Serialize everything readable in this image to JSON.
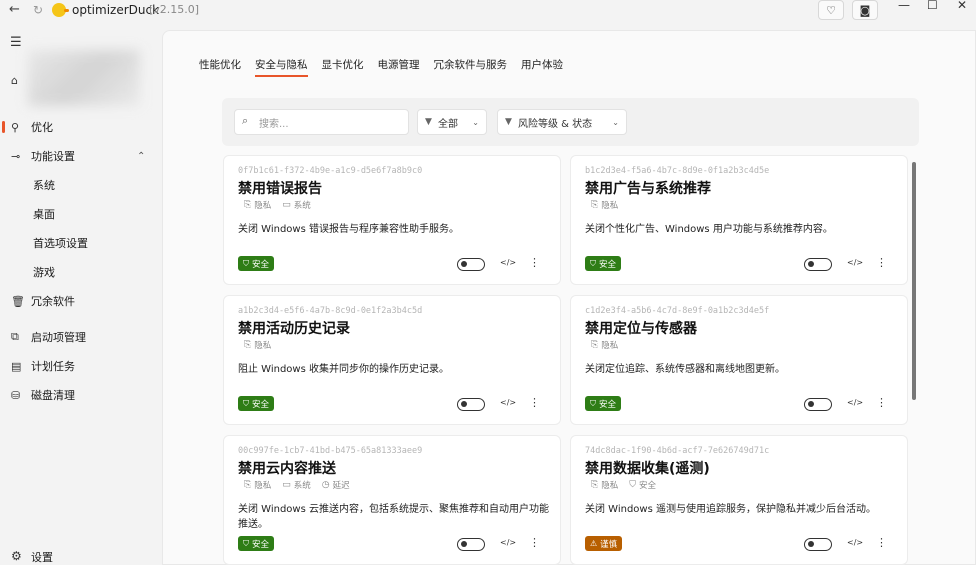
{
  "titlebar": {
    "app_name": "optimizerDuck",
    "version": "[v2.15.0]",
    "back_icon": "arrow-left-icon",
    "refresh_icon": "refresh-icon"
  },
  "sidebar": {
    "items": [
      {
        "id": "optimize",
        "label": "优化",
        "icon": "rocket-icon",
        "active": true
      },
      {
        "id": "feature-settings",
        "label": "功能设置",
        "icon": "toggle-icon",
        "expanded": true
      },
      {
        "id": "system",
        "label": "系统",
        "sub": true
      },
      {
        "id": "desktop",
        "label": "桌面",
        "sub": true
      },
      {
        "id": "preferences",
        "label": "首选项设置",
        "sub": true
      },
      {
        "id": "games",
        "label": "游戏",
        "sub": true
      },
      {
        "id": "bloatware",
        "label": "冗余软件",
        "icon": "trash-icon"
      },
      {
        "id": "startup",
        "label": "启动项管理",
        "icon": "startup-icon"
      },
      {
        "id": "tasks",
        "label": "计划任务",
        "icon": "calendar-icon"
      },
      {
        "id": "disk",
        "label": "磁盘清理",
        "icon": "disk-icon"
      }
    ],
    "settings_label": "设置"
  },
  "tabs": [
    "性能优化",
    "安全与隐私",
    "显卡优化",
    "电源管理",
    "冗余软件与服务",
    "用户体验"
  ],
  "active_tab": 1,
  "filter": {
    "search_placeholder": "搜索...",
    "category_label": "全部",
    "risk_label": "风险等级 & 状态"
  },
  "colors": {
    "accent": "#e8552a",
    "safe": "#2e7d16",
    "caution": "#b85f00"
  },
  "cards": [
    {
      "uuid": "0f7b1c61-f372-4b9e-a1c9-d5e6f7a8b9c0",
      "title": "禁用错误报告",
      "tags": [
        {
          "icon": "privacy-icon",
          "label": "隐私"
        },
        {
          "icon": "monitor-icon",
          "label": "系统"
        }
      ],
      "description": "关闭 Windows 错误报告与程序兼容性助手服务。",
      "badge": "安全",
      "badge_type": "safe"
    },
    {
      "uuid": "b1c2d3e4-f5a6-4b7c-8d9e-0f1a2b3c4d5e",
      "title": "禁用广告与系统推荐",
      "tags": [
        {
          "icon": "privacy-icon",
          "label": "隐私"
        }
      ],
      "description": "关闭个性化广告、Windows 用户功能与系统推荐内容。",
      "badge": "安全",
      "badge_type": "safe"
    },
    {
      "uuid": "a1b2c3d4-e5f6-4a7b-8c9d-0e1f2a3b4c5d",
      "title": "禁用活动历史记录",
      "tags": [
        {
          "icon": "privacy-icon",
          "label": "隐私"
        }
      ],
      "description": "阻止 Windows 收集并同步你的操作历史记录。",
      "badge": "安全",
      "badge_type": "safe"
    },
    {
      "uuid": "c1d2e3f4-a5b6-4c7d-8e9f-0a1b2c3d4e5f",
      "title": "禁用定位与传感器",
      "tags": [
        {
          "icon": "privacy-icon",
          "label": "隐私"
        }
      ],
      "description": "关闭定位追踪、系统传感器和离线地图更新。",
      "badge": "安全",
      "badge_type": "safe"
    },
    {
      "uuid": "00c997fe-1cb7-41bd-b475-65a81333aee9",
      "title": "禁用云内容推送",
      "tags": [
        {
          "icon": "privacy-icon",
          "label": "隐私"
        },
        {
          "icon": "monitor-icon",
          "label": "系统"
        },
        {
          "icon": "clock-icon",
          "label": "延迟"
        }
      ],
      "description": "关闭 Windows 云推送内容，包括系统提示、聚焦推荐和自动用户功能推送。",
      "badge": "安全",
      "badge_type": "safe"
    },
    {
      "uuid": "74dc8dac-1f90-4b6d-acf7-7e626749d71c",
      "title": "禁用数据收集(遥测)",
      "tags": [
        {
          "icon": "privacy-icon",
          "label": "隐私"
        },
        {
          "icon": "shield-icon",
          "label": "安全"
        }
      ],
      "description": "关闭 Windows 遥测与使用追踪服务，保护隐私并减少后台活动。",
      "badge": "谨慎",
      "badge_type": "caution"
    }
  ]
}
